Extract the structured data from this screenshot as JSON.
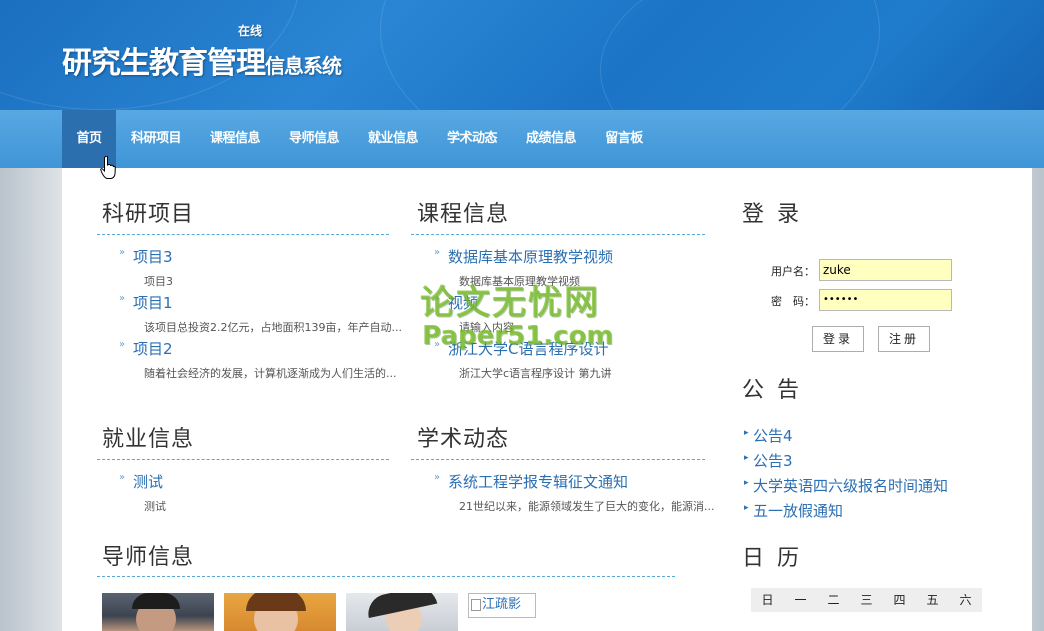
{
  "header": {
    "logo_main": "研究生教育管理",
    "logo_sub": "信息系统",
    "logo_online": "在线"
  },
  "nav": {
    "items": [
      "首页",
      "科研项目",
      "课程信息",
      "导师信息",
      "就业信息",
      "学术动态",
      "成绩信息",
      "留言板"
    ],
    "active": "首页"
  },
  "research": {
    "title": "科研项目",
    "items": [
      {
        "title": "项目3",
        "desc": "项目3"
      },
      {
        "title": "项目1",
        "desc": "该项目总投资2.2亿元，占地面积139亩，年产自动..."
      },
      {
        "title": "项目2",
        "desc": "随着社会经济的发展，计算机逐渐成为人们生活的..."
      }
    ]
  },
  "courses": {
    "title": "课程信息",
    "items": [
      {
        "title": "数据库基本原理教学视频",
        "desc": "数据库基本原理教学视频"
      },
      {
        "title": "视频",
        "desc": "请输入内容"
      },
      {
        "title": "浙江大学C语言程序设计",
        "desc": "浙江大学c语言程序设计 第九讲"
      }
    ]
  },
  "jobs": {
    "title": "就业信息",
    "items": [
      {
        "title": "测试",
        "desc": "测试"
      }
    ]
  },
  "academic": {
    "title": "学术动态",
    "items": [
      {
        "title": "系统工程学报专辑征文通知",
        "desc": "21世纪以来，能源领域发生了巨大的变化，能源消..."
      }
    ]
  },
  "tutors": {
    "title": "导师信息",
    "broken_image_alt": "江疏影"
  },
  "login": {
    "title": "登 录",
    "username_label": "用户名：",
    "username_value": "zuke",
    "password_label": "密　码：",
    "password_value": "••••••",
    "login_button": "登录",
    "register_button": "注册"
  },
  "announcements": {
    "title": "公 告",
    "items": [
      "公告4",
      "公告3",
      "大学英语四六级报名时间通知",
      "五一放假通知"
    ]
  },
  "calendar": {
    "title": "日 历",
    "weekdays": [
      "日",
      "一",
      "二",
      "三",
      "四",
      "五",
      "六"
    ]
  },
  "watermark": {
    "line1": "论文无忧网",
    "line2": "Paper51.com"
  },
  "colors": {
    "accent": "#2b6fb3",
    "nav_bg": "#4a9fdd",
    "nav_active": "#2c6fae",
    "header_bg": "#1f7ccc",
    "input_bg": "#ffffc0"
  }
}
